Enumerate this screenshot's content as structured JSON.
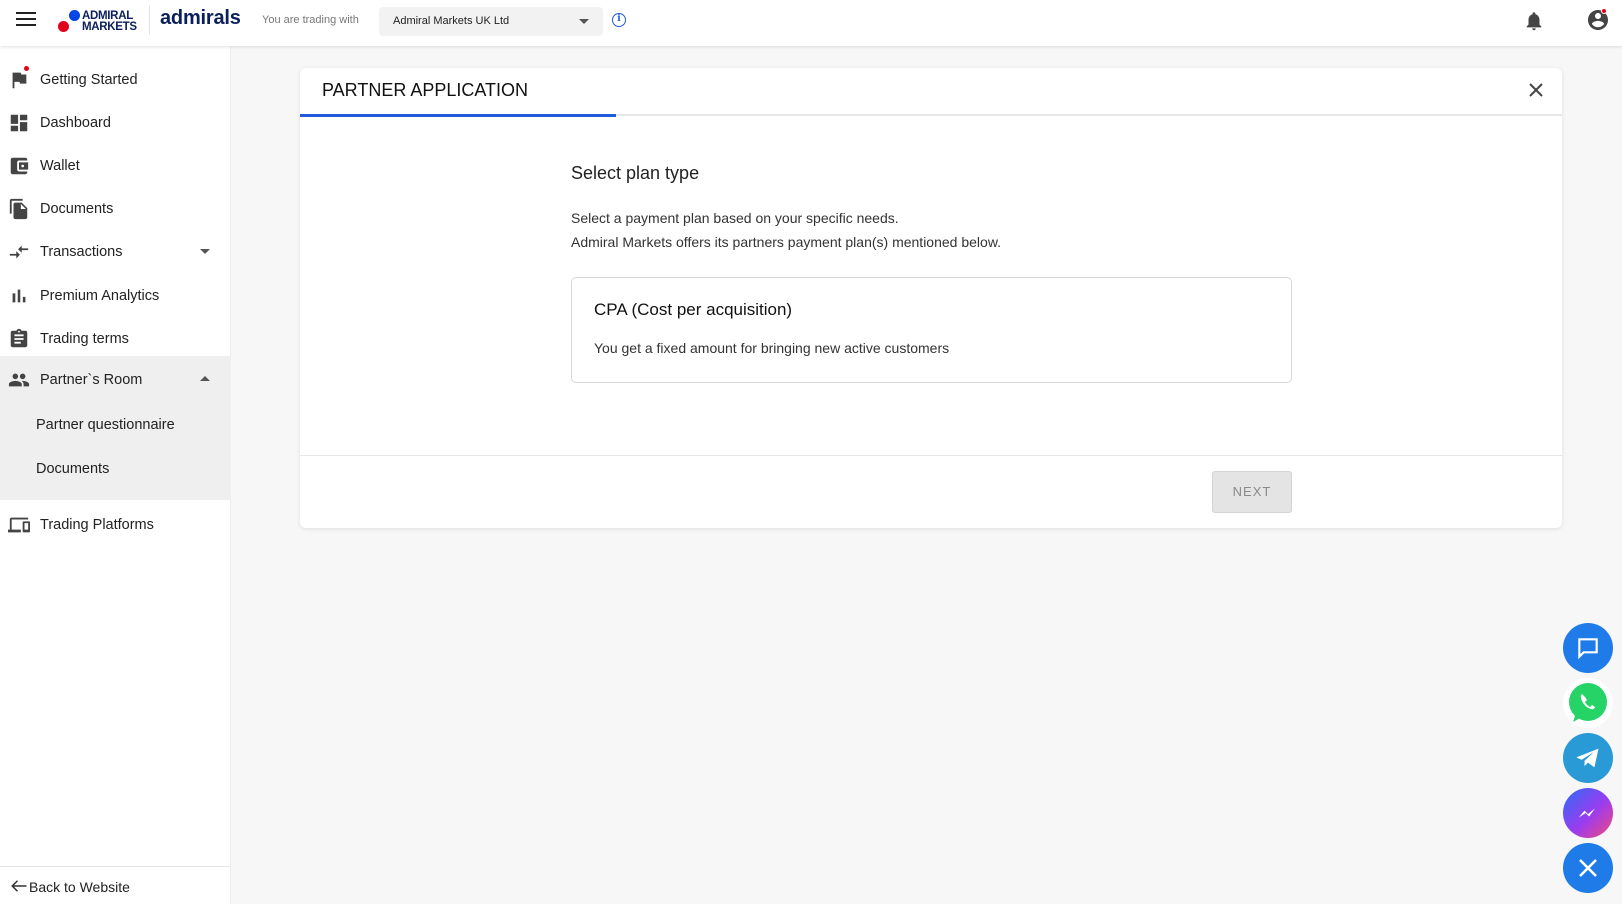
{
  "header": {
    "logo_text_line1": "ADMIRAL",
    "logo_text_line2": "MARKETS",
    "brand": "admirals",
    "trading_with_label": "You are trading with",
    "entity_selected": "Admiral Markets UK Ltd",
    "icons": [
      "hamburger-icon",
      "info-icon",
      "bell-icon",
      "account-icon"
    ]
  },
  "sidebar": {
    "items": [
      {
        "label": "Getting Started",
        "icon": "flag-icon"
      },
      {
        "label": "Dashboard",
        "icon": "dashboard-icon"
      },
      {
        "label": "Wallet",
        "icon": "wallet-icon"
      },
      {
        "label": "Documents",
        "icon": "documents-icon"
      },
      {
        "label": "Transactions",
        "icon": "transactions-icon"
      },
      {
        "label": "Premium Analytics",
        "icon": "bar-chart-icon"
      },
      {
        "label": "Trading terms",
        "icon": "clipboard-icon"
      },
      {
        "label": "Partner`s Room",
        "icon": "people-icon"
      },
      {
        "label": "Trading Platforms",
        "icon": "devices-icon"
      }
    ],
    "partner_sub_items": [
      {
        "label": "Partner questionnaire"
      },
      {
        "label": "Documents"
      }
    ],
    "back_label": "Back to Website"
  },
  "card": {
    "title": "PARTNER APPLICATION",
    "progress_fraction": 0.25,
    "section_title": "Select plan type",
    "description_line1": "Select a payment plan based on your specific needs.",
    "description_line2": "Admiral Markets offers its partners payment plan(s) mentioned below.",
    "plan": {
      "title": "CPA (Cost per acquisition)",
      "description": "You get a fixed amount for bringing new active customers"
    },
    "next_label": "NEXT"
  },
  "colors": {
    "accent": "#1f5bdc",
    "brand_red": "#e3001b",
    "brand_navy": "#0a1f5c",
    "whatsapp": "#25d366",
    "telegram": "#2a9ad6"
  },
  "floating_buttons": [
    "chat-icon",
    "whatsapp-icon",
    "telegram-icon",
    "messenger-icon",
    "close-icon"
  ]
}
